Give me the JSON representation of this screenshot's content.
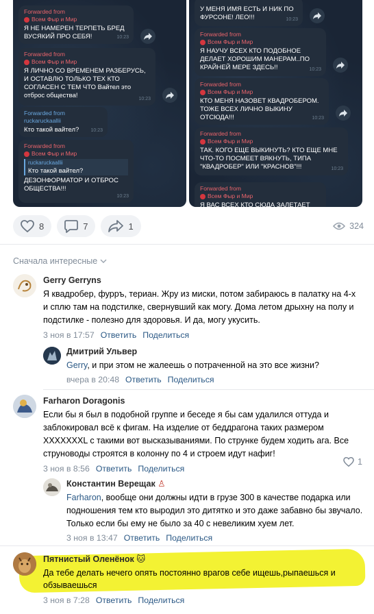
{
  "screenshots": {
    "left": [
      {
        "forwarded": "Forwarded from",
        "source": "Всем Фыр и Мир",
        "text": "Я НЕ НАМЕРЕН ТЕРПЕТЬ БРЕД ВУСЯКИЙ ПРО СЕБЯ!",
        "time": "10:23"
      },
      {
        "forwarded": "Forwarded from",
        "source": "Всем Фыр и Мир",
        "text": "Я ЛИЧНО СО ВРЕМЕНЕМ РАЗБЕРУСЬ, И ОСТАВЛЮ ТОЛЬКО ТЕХ КТО СОГЛАСЕН С ТЕМ ЧТО Вайтел это отброс общества!",
        "time": "10:23"
      },
      {
        "forwarded": "Forwarded from",
        "source": "ruckaruckaallii",
        "text": "Кто такой вайтел?",
        "time": "10:23"
      },
      {
        "forwarded": "Forwarded from",
        "source": "Всем Фыр и Мир",
        "quote_name": "ruckaruckaallii",
        "quote_text": "Кто такой вайтел?",
        "text": "ДЕЗОНФОРМАТОР И ОТБРОС ОБЩЕСТВА!!!",
        "time": "10:23"
      }
    ],
    "right": [
      {
        "text": "У МЕНЯ ИМЯ ЕСТЬ И НИК ПО ФУРСОНЕ! ЛЕО!!!",
        "time": "10:23"
      },
      {
        "forwarded": "Forwarded from",
        "source": "Всем Фыр и Мир",
        "text": "Я НАУЧУ ВСЕХ КТО ПОДОБНОЕ ДЕЛАЕТ ХОРОШИМ МАНЕРАМ..ПО КРАЙНЕЙ МЕРЕ ЗДЕСЬ!!",
        "time": "10:23"
      },
      {
        "forwarded": "Forwarded from",
        "source": "Всем Фыр и Мир",
        "text": "КТО МЕНЯ НАЗОВЕТ КВАДРОБЕРОМ. ТОЖЕ ВСЕХ ЛИЧНО ВЫКИНУ ОТСЮДА!!!",
        "time": "10:23"
      },
      {
        "forwarded": "Forwarded from",
        "source": "Всем Фыр и Мир",
        "text": "ТАК. КОГО ЕЩЕ ВЫКИНУТЬ? КТО ЕЩЕ МНЕ ЧТО-ТО ПОСМЕЕТ ВЯКНУТЬ, ТИПА \"КВАДРОБЕР\" ИЛИ \"КРАСНОВ\"!!!",
        "time": "10:23"
      },
      {
        "forwarded": "Forwarded from",
        "source": "Всем Фыр и Мир",
        "text": "Я ВАС ВСЕХ КТО СЮДА ЗАЛЕТАЕТ"
      }
    ]
  },
  "actions": {
    "likes": "8",
    "comments": "7",
    "reposts": "1",
    "views": "324"
  },
  "sort_label": "Сначала интересные",
  "comments": [
    {
      "author": "Gerry Gerryns",
      "text": "Я квадробер, фурръ, териан. Жру из миски, потом забираюсь в палатку на 4-х и сплю там на подстилке, свернувший как могу. Дома летом дрыхну на полу и подстилке - полезно для здоровья. И да, могу укусить.",
      "date": "3 ноя в 17:57",
      "reply": "Ответить",
      "share": "Поделиться"
    },
    {
      "author": "Дмитрий Ульвер",
      "mention": "Gerry",
      "text": ", и при этом не жалеешь о потраченной на это все жизни?",
      "date": "вчера в 20:48",
      "reply": "Ответить",
      "share": "Поделиться"
    },
    {
      "author": "Farharon Doragonis",
      "text": "Если бы я был в подобной группе и беседе я бы сам удалился оттуда и заблокировал всё к фигам. На изделие от беддрагона таких размером XXXXXXXL с такими вот высказываниями. По струнке будем ходить ага. Все струноводы строятся в колонну по 4 и строем идут нафиг!",
      "date": "3 ноя в 8:56",
      "reply": "Ответить",
      "share": "Поделиться",
      "likes": "1"
    },
    {
      "author": "Константин Верещак",
      "mention": "Farharon",
      "text": ", вообще они должны идти в грузе 300 в качестве подарка или подношения тем кто выродил это дитятко и это даже забавно бы звучало. Только если бы ему не было за 40 с невеликим хуем лет.",
      "date": "3 ноя в 13:47",
      "reply": "Ответить",
      "share": "Поделиться"
    },
    {
      "author": "Пятнистый Оленёнок",
      "text": "Да тебе делать нечего опять постоянно врагов себе ищешь,рыпаешься и обзываешься",
      "date": "3 ноя в 7:28",
      "reply": "Ответить",
      "share": "Поделиться"
    }
  ],
  "colors": {
    "link": "#2a5885",
    "meta": "#818c99",
    "highlight": "#f3f233",
    "telegram_bg": "#1a2535"
  }
}
